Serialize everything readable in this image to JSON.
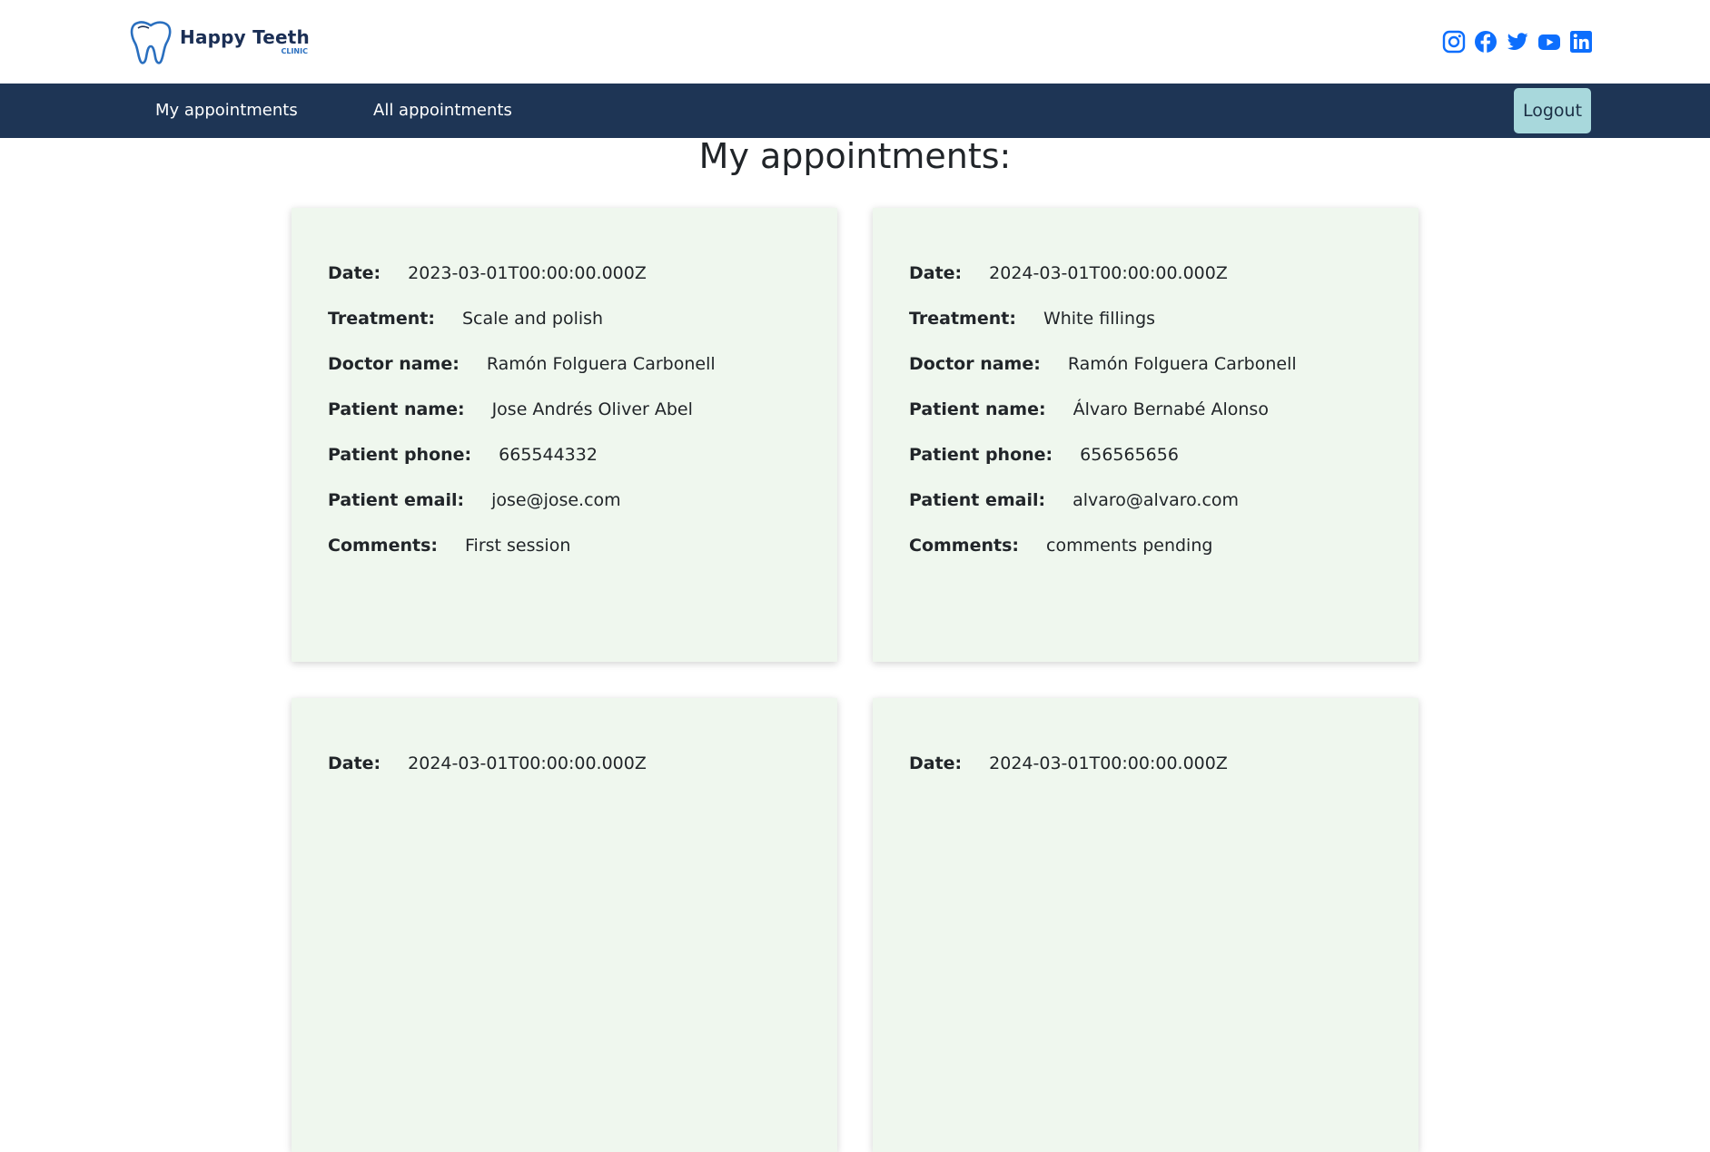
{
  "header": {
    "logo_name": "Happy Teeth",
    "logo_sub": "CLINIC",
    "social_icons": [
      "instagram-icon",
      "facebook-icon",
      "twitter-icon",
      "youtube-icon",
      "linkedin-icon"
    ],
    "accent_color": "#0d6efd"
  },
  "nav": {
    "my_appointments": "My appointments",
    "all_appointments": "All appointments",
    "logout": "Logout",
    "bg_color": "#1e3555"
  },
  "main": {
    "title": "My appointments:",
    "labels": {
      "date": "Date:",
      "treatment": "Treatment:",
      "doctor": "Doctor name:",
      "patient": "Patient name:",
      "phone": "Patient phone:",
      "email": "Patient email:",
      "comments": "Comments:"
    },
    "appointments": [
      {
        "date": "2023-03-01T00:00:00.000Z",
        "treatment": "Scale and polish",
        "doctor": "Ramón Folguera Carbonell",
        "patient": "Jose Andrés Oliver Abel",
        "phone": "665544332",
        "email": "jose@jose.com",
        "comments": "First session"
      },
      {
        "date": "2024-03-01T00:00:00.000Z",
        "treatment": "White fillings",
        "doctor": "Ramón Folguera Carbonell",
        "patient": "Álvaro Bernabé Alonso",
        "phone": "656565656",
        "email": "alvaro@alvaro.com",
        "comments": "comments pending"
      },
      {
        "date": "2024-03-01T00:00:00.000Z"
      },
      {
        "date": "2024-03-01T00:00:00.000Z"
      }
    ]
  }
}
